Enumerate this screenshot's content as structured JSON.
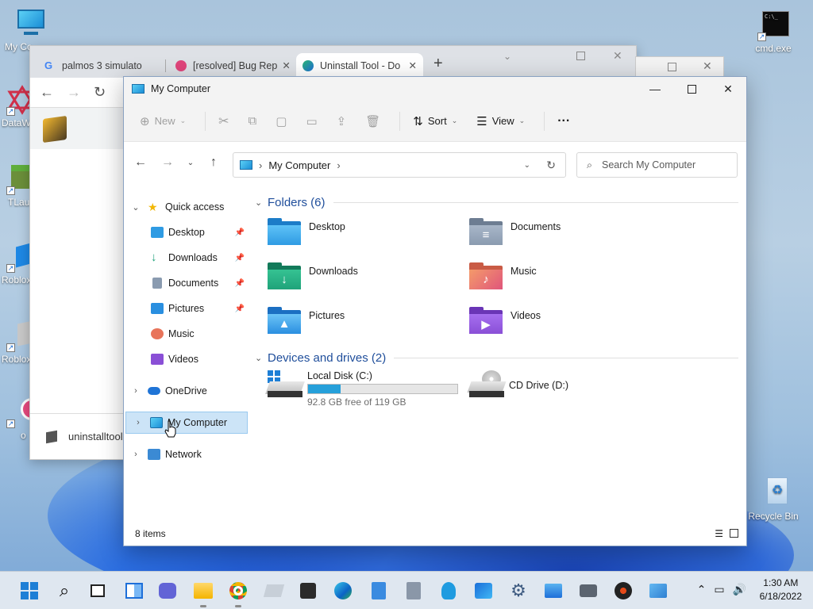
{
  "desktop": {
    "icons": [
      {
        "label": "My Co",
        "icon": "monitor-icon"
      },
      {
        "label": "DataW",
        "icon": "datawarp-icon"
      },
      {
        "label": "TLau",
        "icon": "minecraft-icon"
      },
      {
        "label": "Roblox",
        "icon": "roblox-icon"
      },
      {
        "label": "Roblox",
        "icon": "roblox-studio-icon"
      },
      {
        "label": "o",
        "icon": "os-icon"
      },
      {
        "label": "cmd.exe",
        "icon": "cmd-icon"
      },
      {
        "label": "Recycle Bin",
        "icon": "recycle-bin-icon"
      }
    ]
  },
  "chrome": {
    "tabs": [
      {
        "label": "palmos 3 simulato",
        "icon": "google-icon"
      },
      {
        "label": "[resolved] Bug Rep",
        "icon": "forum-icon"
      },
      {
        "label": "Uninstall Tool - Do",
        "icon": "uninstall-tool-icon"
      }
    ],
    "new_tab": "+",
    "download_item": "uninstalltool"
  },
  "explorer": {
    "title": "My Computer",
    "commands": {
      "new": "New",
      "sort": "Sort",
      "view": "View",
      "more": "···"
    },
    "address": {
      "crumb": "My Computer"
    },
    "search_placeholder": "Search My Computer",
    "nav": {
      "quick_access": "Quick access",
      "pinned": [
        {
          "label": "Desktop",
          "icon": "desktop-folder-icon",
          "pinned": true
        },
        {
          "label": "Downloads",
          "icon": "downloads-icon",
          "pinned": true
        },
        {
          "label": "Documents",
          "icon": "documents-icon",
          "pinned": true
        },
        {
          "label": "Pictures",
          "icon": "pictures-icon",
          "pinned": true
        },
        {
          "label": "Music",
          "icon": "music-icon",
          "pinned": false
        },
        {
          "label": "Videos",
          "icon": "videos-icon",
          "pinned": false
        }
      ],
      "onedrive": "OneDrive",
      "my_computer": "My Computer",
      "network": "Network"
    },
    "groups": {
      "folders_title": "Folders (6)",
      "drives_title": "Devices and drives (2)"
    },
    "folders": [
      {
        "label": "Desktop",
        "color": "#2f9be3",
        "glyph": ""
      },
      {
        "label": "Documents",
        "color": "#8a9bb0",
        "glyph": "≡"
      },
      {
        "label": "Downloads",
        "color": "#1fa37a",
        "glyph": "↓"
      },
      {
        "label": "Music",
        "color": "#e8745a",
        "glyph": "♪"
      },
      {
        "label": "Pictures",
        "color": "#2a8fe0",
        "glyph": "▲"
      },
      {
        "label": "Videos",
        "color": "#8a4fd6",
        "glyph": "▶"
      }
    ],
    "drives": [
      {
        "label": "Local Disk (C:)",
        "free_text": "92.8 GB free of 119 GB",
        "used_fraction": 0.22
      },
      {
        "label": "CD Drive (D:)"
      }
    ],
    "status": {
      "items": "8 items"
    }
  },
  "taskbar": {
    "apps": [
      "start-icon",
      "search-icon",
      "task-view-icon",
      "widgets-icon",
      "chat-icon",
      "file-explorer-icon",
      "chrome-icon",
      "app-icon",
      "store-icon",
      "edge-icon",
      "notepad-icon",
      "calculator-icon",
      "tips-icon",
      "media-player-icon",
      "settings-icon",
      "photos-icon",
      "camera-icon",
      "music-disc-icon",
      "control-panel-icon"
    ],
    "time": "1:30 AM",
    "date": "6/18/2022"
  }
}
